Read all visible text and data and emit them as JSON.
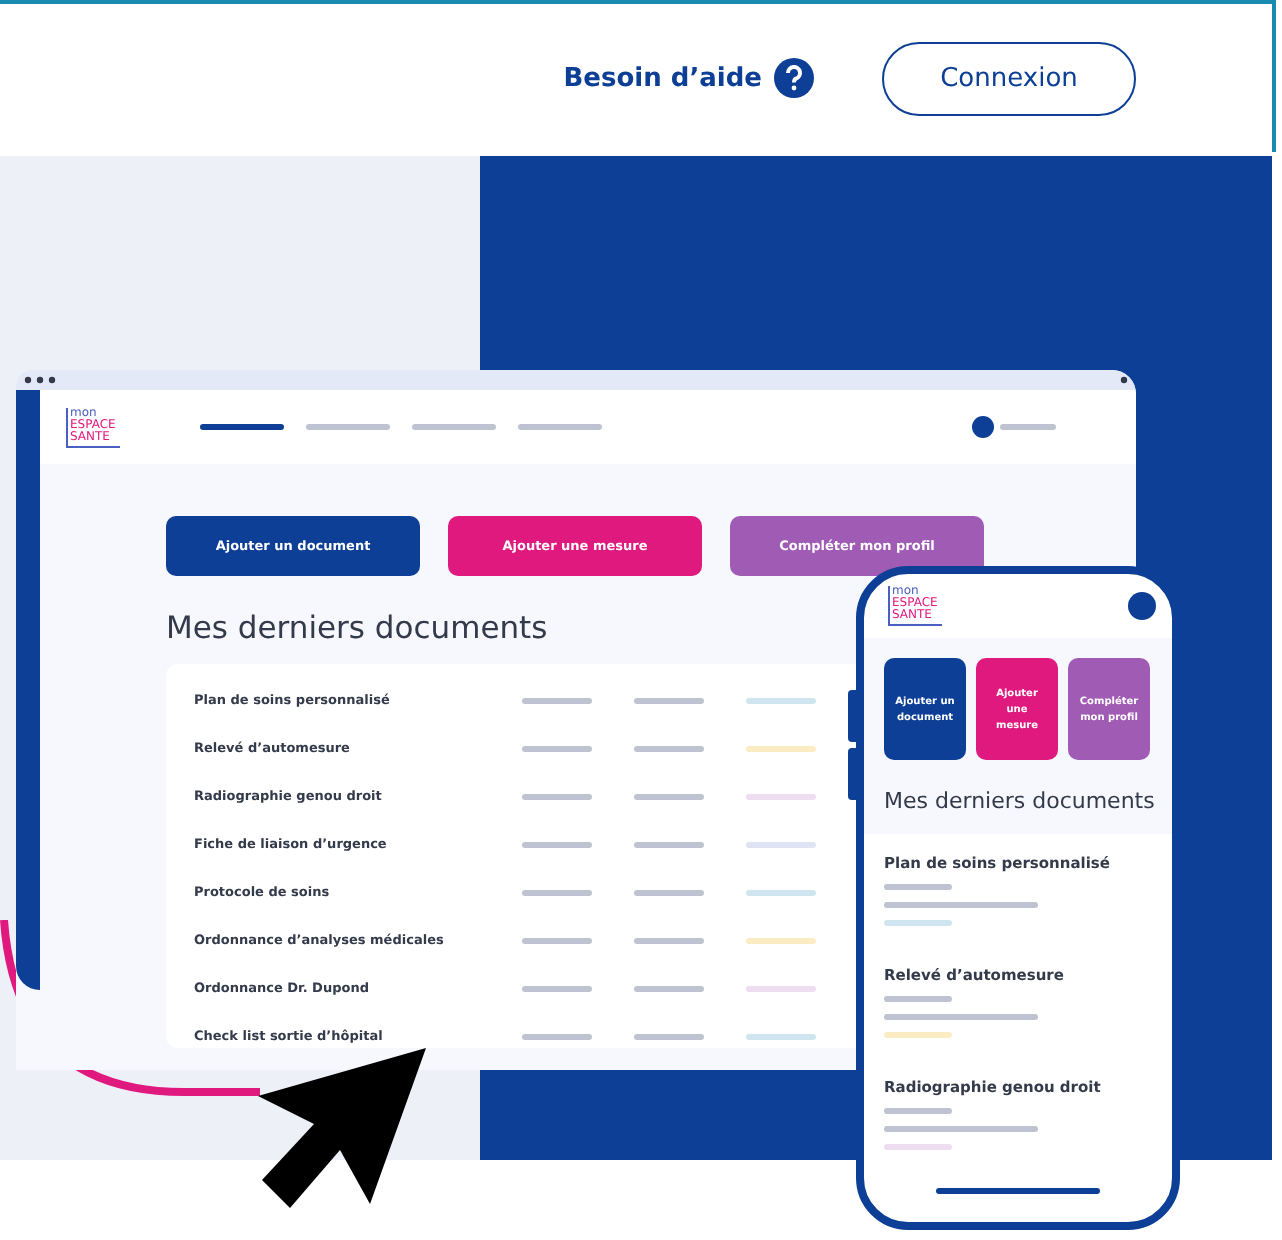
{
  "header": {
    "help_link": "Besoin d’aide",
    "login_button": "Connexion"
  },
  "laptop": {
    "logo": [
      "mon",
      "ESPACE",
      "SANTE"
    ],
    "nav": [
      {
        "selected": true
      },
      {
        "selected": false
      },
      {
        "selected": false
      },
      {
        "selected": false
      }
    ],
    "actions": [
      {
        "label": "Ajouter un document",
        "color": "#0c3f95"
      },
      {
        "label": "Ajouter une mesure",
        "color": "#e0197f"
      },
      {
        "label": "Compléter mon profil",
        "color": "#a05cb5"
      }
    ],
    "section_title": "Mes derniers documents",
    "documents": [
      {
        "name": "Plan de soins personnalisé",
        "color": "#cfe6f0"
      },
      {
        "name": "Relevé d’automesure",
        "color": "#fbecc4"
      },
      {
        "name": "Radiographie genou droit",
        "color": "#eedcf0"
      },
      {
        "name": "Fiche de liaison d’urgence",
        "color": "#dfe3f3"
      },
      {
        "name": "Protocole de soins",
        "color": "#cfe6f0"
      },
      {
        "name": "Ordonnance d’analyses médicales",
        "color": "#fbecc4"
      },
      {
        "name": "Ordonnance Dr. Dupond",
        "color": "#eedcf0"
      },
      {
        "name": "Check list sortie d’hôpital",
        "color": "#cfe6f0"
      }
    ]
  },
  "phone": {
    "logo": [
      "mon",
      "ESPACE",
      "SANTE"
    ],
    "actions": [
      {
        "label": "Ajouter un document",
        "color": "#0c3f95"
      },
      {
        "label": "Ajouter une mesure",
        "color": "#e0197f"
      },
      {
        "label": "Compléter mon profil",
        "color": "#a05cb5"
      }
    ],
    "section_title": "Mes derniers documents",
    "documents": [
      {
        "name": "Plan de soins personnalisé",
        "color": "#cfe6f0"
      },
      {
        "name": "Relevé d’automesure",
        "color": "#fbecc4"
      },
      {
        "name": "Radiographie genou droit",
        "color": "#eedcf0"
      }
    ]
  }
}
